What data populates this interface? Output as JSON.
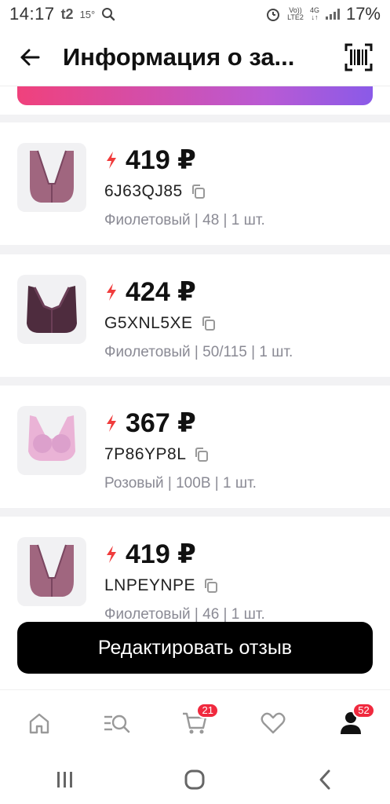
{
  "status": {
    "time": "14:17",
    "carrier_icon_text": "t2",
    "temperature": "15°",
    "net_top": "Vo))",
    "net_bottom": "LTE2",
    "net_type": "4G",
    "battery": "17%"
  },
  "header": {
    "title": "Информация о за..."
  },
  "colors": {
    "accent_red": "#f0293e",
    "lightning": "#f03c3c",
    "button_bg": "#000000",
    "meta_text": "#8a8a94"
  },
  "products": [
    {
      "price": "419 ₽",
      "code": "6J63QJ85",
      "meta": "Фиолетовый | 48 | 1 шт.",
      "image": "lace-bra-purple"
    },
    {
      "price": "424 ₽",
      "code": "G5XNL5XE",
      "meta": "Фиолетовый | 50/115 | 1 шт.",
      "image": "bra-dark-purple"
    },
    {
      "price": "367 ₽",
      "code": "7P86YP8L",
      "meta": "Розовый | 100B | 1 шт.",
      "image": "bra-pink"
    },
    {
      "price": "419 ₽",
      "code": "LNPEYNPE",
      "meta": "Фиолетовый | 46 | 1 шт.",
      "image": "lace-bra-purple"
    }
  ],
  "actions": {
    "edit_review": "Редактировать отзыв"
  },
  "bottom_nav": {
    "cart_badge": "21",
    "profile_badge": "52",
    "items": [
      "home-icon",
      "catalog-search-icon",
      "cart-icon",
      "heart-icon",
      "profile-icon"
    ]
  }
}
